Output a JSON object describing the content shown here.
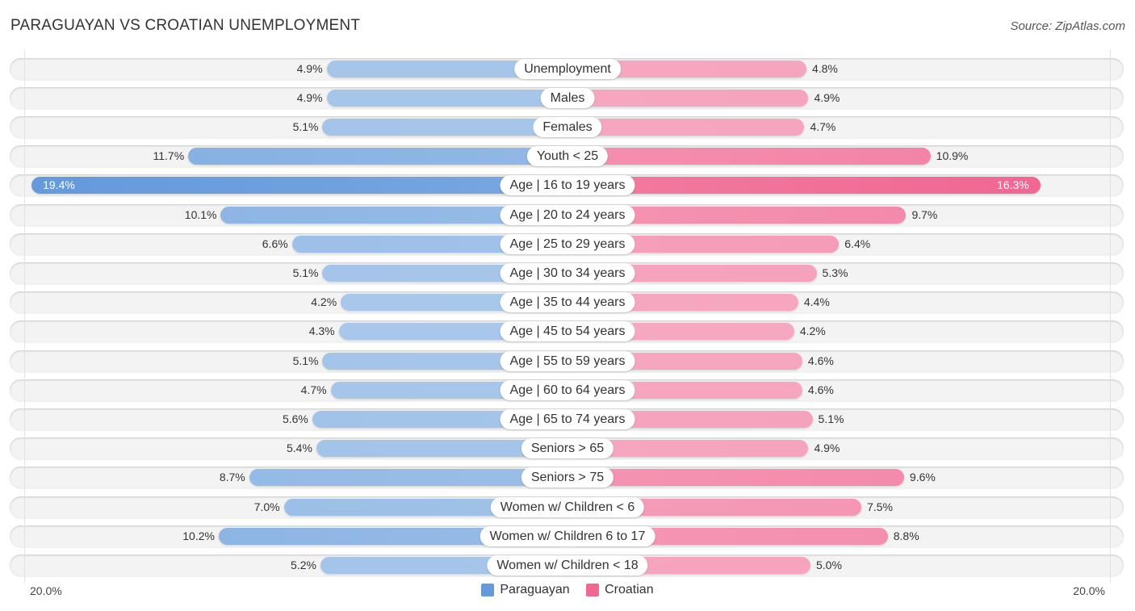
{
  "header": {
    "title": "PARAGUAYAN VS CROATIAN UNEMPLOYMENT",
    "source": "Source: ZipAtlas.com"
  },
  "chart_data": {
    "type": "bar",
    "orientation": "horizontal-diverging",
    "title": "PARAGUAYAN VS CROATIAN UNEMPLOYMENT",
    "xlabel": "",
    "ylabel": "",
    "axis_min_label": "20.0%",
    "axis_max_label": "20.0%",
    "xlim": [
      0,
      20
    ],
    "legend_position": "bottom-center",
    "categories": [
      "Unemployment",
      "Males",
      "Females",
      "Youth < 25",
      "Age | 16 to 19 years",
      "Age | 20 to 24 years",
      "Age | 25 to 29 years",
      "Age | 30 to 34 years",
      "Age | 35 to 44 years",
      "Age | 45 to 54 years",
      "Age | 55 to 59 years",
      "Age | 60 to 64 years",
      "Age | 65 to 74 years",
      "Seniors > 65",
      "Seniors > 75",
      "Women w/ Children < 6",
      "Women w/ Children 6 to 17",
      "Women w/ Children < 18"
    ],
    "series": [
      {
        "name": "Paraguayan",
        "color": "#6499dc",
        "color_light": "#a9c8ea",
        "side": "left",
        "values": [
          4.9,
          4.9,
          5.1,
          11.7,
          19.4,
          10.1,
          6.6,
          5.1,
          4.2,
          4.3,
          5.1,
          4.7,
          5.6,
          5.4,
          8.7,
          7.0,
          10.2,
          5.2
        ],
        "labels": [
          "4.9%",
          "4.9%",
          "5.1%",
          "11.7%",
          "19.4%",
          "10.1%",
          "6.6%",
          "5.1%",
          "4.2%",
          "4.3%",
          "5.1%",
          "4.7%",
          "5.6%",
          "5.4%",
          "8.7%",
          "7.0%",
          "10.2%",
          "5.2%"
        ]
      },
      {
        "name": "Croatian",
        "color": "#f06792",
        "color_light": "#f6a9c1",
        "side": "right",
        "values": [
          4.8,
          4.9,
          4.7,
          10.9,
          16.3,
          9.7,
          6.4,
          5.3,
          4.4,
          4.2,
          4.6,
          4.6,
          5.1,
          4.9,
          9.6,
          7.5,
          8.8,
          5.0
        ],
        "labels": [
          "4.8%",
          "4.9%",
          "4.7%",
          "10.9%",
          "16.3%",
          "9.7%",
          "6.4%",
          "5.3%",
          "4.4%",
          "4.2%",
          "4.6%",
          "4.6%",
          "5.1%",
          "4.9%",
          "9.6%",
          "7.5%",
          "8.8%",
          "5.0%"
        ]
      }
    ]
  }
}
